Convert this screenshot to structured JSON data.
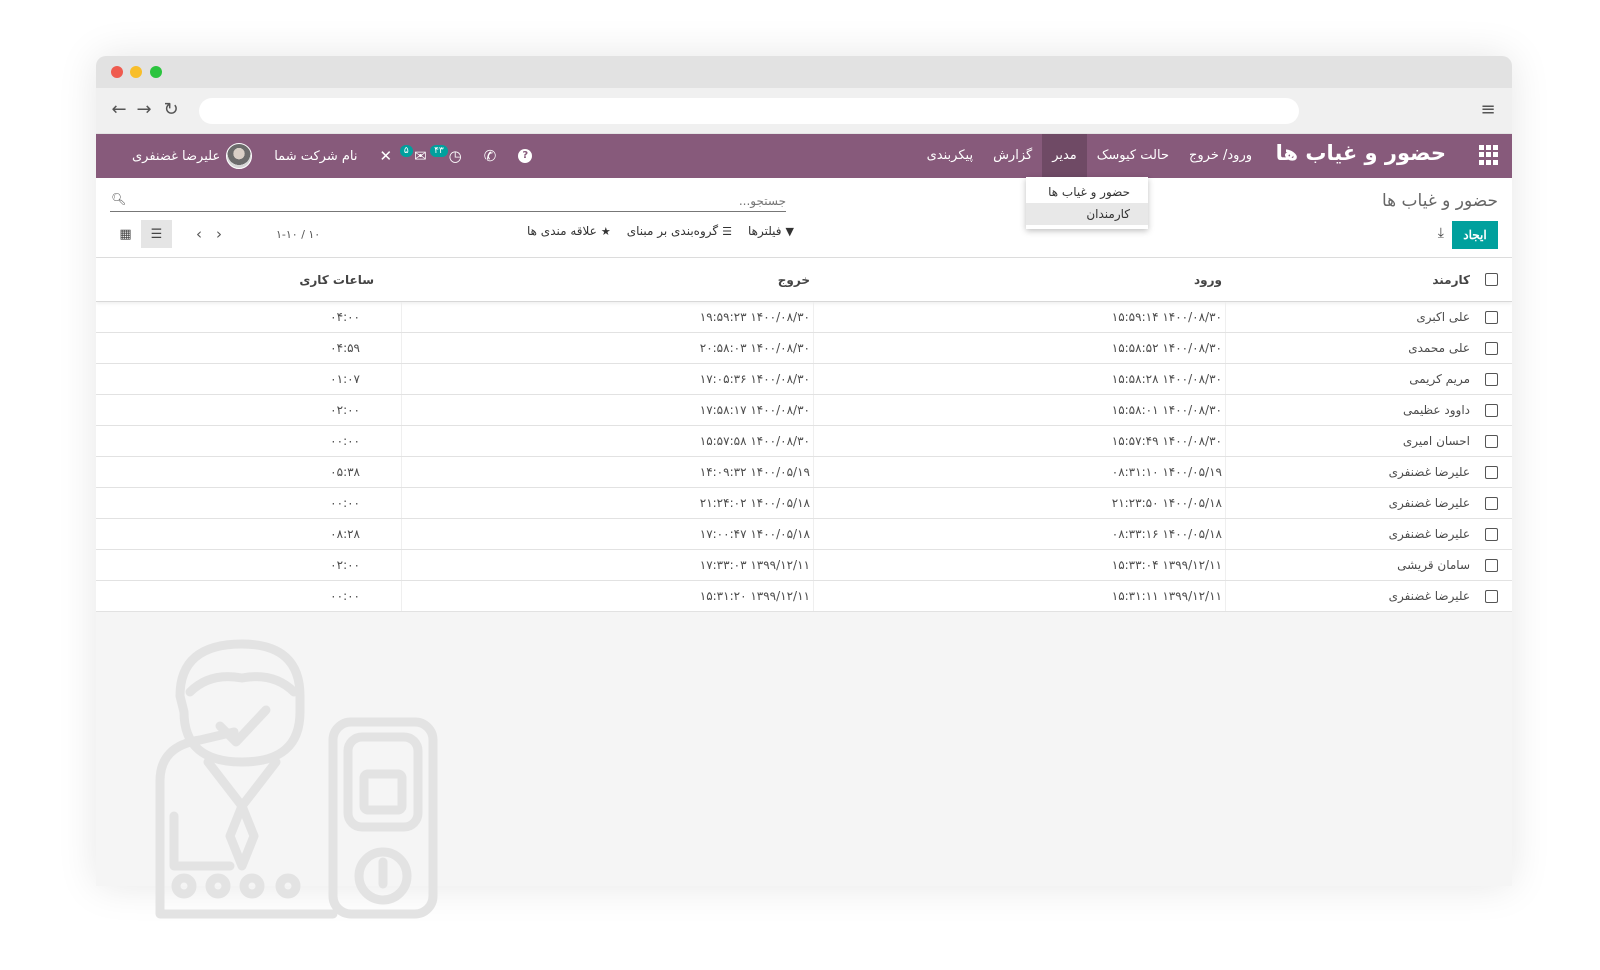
{
  "app": {
    "title": "حضور و غیاب ها",
    "menu": [
      "ورود/ خروج",
      "حالت کیوسک",
      "مدیر",
      "گزارش",
      "پیکربندی"
    ],
    "active_menu": "مدیر"
  },
  "systray": {
    "user_name": "علیرضا غضنفری",
    "company": "نام شرکت شما",
    "messages_badge": "۵",
    "activities_badge": "۴۳"
  },
  "dropdown": {
    "items": [
      "حضور و غیاب ها",
      "کارمندان"
    ]
  },
  "control_panel": {
    "breadcrumb": "حضور و غیاب ها",
    "search_placeholder": "جستجو...",
    "create_label": "ایجاد",
    "filters_label": "فیلترها",
    "groupby_label": "گروه‌بندی بر مبنای",
    "favorites_label": "علاقه مندی ها",
    "pager_value": "۱-۱۰ / ۱۰"
  },
  "columns": {
    "employee": "کارمند",
    "check_in": "ورود",
    "check_out": "خروج",
    "worked_hours": "ساعات کاری"
  },
  "rows": [
    {
      "employee": "علی اکبری",
      "check_in": "۱۴۰۰/۰۸/۳۰ ۱۵:۵۹:۱۴",
      "check_out": "۱۴۰۰/۰۸/۳۰ ۱۹:۵۹:۲۳",
      "worked_hours": "۰۴:۰۰"
    },
    {
      "employee": "علی محمدی",
      "check_in": "۱۴۰۰/۰۸/۳۰ ۱۵:۵۸:۵۲",
      "check_out": "۱۴۰۰/۰۸/۳۰ ۲۰:۵۸:۰۳",
      "worked_hours": "۰۴:۵۹"
    },
    {
      "employee": "مریم کریمی",
      "check_in": "۱۴۰۰/۰۸/۳۰ ۱۵:۵۸:۲۸",
      "check_out": "۱۴۰۰/۰۸/۳۰ ۱۷:۰۵:۳۶",
      "worked_hours": "۰۱:۰۷"
    },
    {
      "employee": "داوود عظیمی",
      "check_in": "۱۴۰۰/۰۸/۳۰ ۱۵:۵۸:۰۱",
      "check_out": "۱۴۰۰/۰۸/۳۰ ۱۷:۵۸:۱۷",
      "worked_hours": "۰۲:۰۰"
    },
    {
      "employee": "احسان امیری",
      "check_in": "۱۴۰۰/۰۸/۳۰ ۱۵:۵۷:۴۹",
      "check_out": "۱۴۰۰/۰۸/۳۰ ۱۵:۵۷:۵۸",
      "worked_hours": "۰۰:۰۰"
    },
    {
      "employee": "علیرضا غضنفری",
      "check_in": "۱۴۰۰/۰۵/۱۹ ۰۸:۳۱:۱۰",
      "check_out": "۱۴۰۰/۰۵/۱۹ ۱۴:۰۹:۳۲",
      "worked_hours": "۰۵:۳۸"
    },
    {
      "employee": "علیرضا غضنفری",
      "check_in": "۱۴۰۰/۰۵/۱۸ ۲۱:۲۳:۵۰",
      "check_out": "۱۴۰۰/۰۵/۱۸ ۲۱:۲۴:۰۲",
      "worked_hours": "۰۰:۰۰"
    },
    {
      "employee": "علیرضا غضنفری",
      "check_in": "۱۴۰۰/۰۵/۱۸ ۰۸:۳۳:۱۶",
      "check_out": "۱۴۰۰/۰۵/۱۸ ۱۷:۰۰:۴۷",
      "worked_hours": "۰۸:۲۸"
    },
    {
      "employee": "سامان قریشی",
      "check_in": "۱۳۹۹/۱۲/۱۱ ۱۵:۳۳:۰۴",
      "check_out": "۱۳۹۹/۱۲/۱۱ ۱۷:۳۳:۰۳",
      "worked_hours": "۰۲:۰۰"
    },
    {
      "employee": "علیرضا غضنفری",
      "check_in": "۱۳۹۹/۱۲/۱۱ ۱۵:۳۱:۱۱",
      "check_out": "۱۳۹۹/۱۲/۱۱ ۱۵:۳۱:۲۰",
      "worked_hours": "۰۰:۰۰"
    }
  ],
  "colors": {
    "navbar": "#875a7b",
    "navbar_active": "#6f4a65",
    "primary_button": "#00a09d",
    "badge": "#00a09d"
  },
  "icons": {
    "apps": "grid-icon",
    "search": "search-icon",
    "download": "download-icon",
    "filter": "filter-icon",
    "groupby": "list-icon",
    "favorites": "star-icon",
    "list_view": "list-view-icon",
    "kanban_view": "kanban-view-icon",
    "help": "help-icon",
    "phone": "phone-icon",
    "clock": "clock-icon",
    "chat": "chat-icon",
    "debug": "debug-icon"
  }
}
